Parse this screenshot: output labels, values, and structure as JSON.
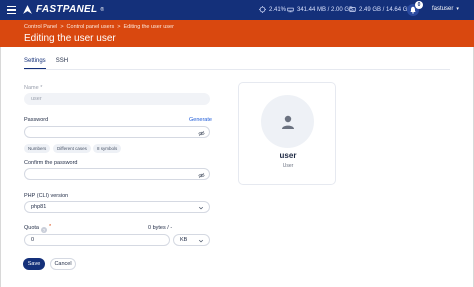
{
  "topbar": {
    "brand": "FASTPANEL",
    "brand_reg": "®",
    "cpu": "2.41%",
    "memory": "341.44 MB / 2.00 GB",
    "disk": "2.49 GB / 14.64 GB",
    "notifications_count": "0",
    "username": "fastuser"
  },
  "header": {
    "breadcrumbs": [
      "Control Panel",
      "Control panel users",
      "Editing the user user"
    ],
    "breadcrumb_sep": ">",
    "title": "Editing the user user"
  },
  "tabs": [
    {
      "label": "Settings",
      "active": true
    },
    {
      "label": "SSH",
      "active": false
    }
  ],
  "form": {
    "name_label": "Name",
    "name_required": "*",
    "name_value": "user",
    "password_label": "Password",
    "generate_link": "Generate",
    "password_value": "",
    "password_hints": [
      "Numbers",
      "Different cases",
      "8 symbols"
    ],
    "confirm_label": "Confirm the password",
    "confirm_value": "",
    "php_label": "PHP (CLI) version",
    "php_value": "php81",
    "quota_label": "Quota",
    "quota_required": "*",
    "quota_usage": "0 bytes / -",
    "quota_value": "0",
    "quota_unit": "KB"
  },
  "buttons": {
    "save": "Save",
    "cancel": "Cancel"
  },
  "user_card": {
    "name": "user",
    "role": "User"
  },
  "colors": {
    "topbar": "#14307a",
    "header": "#d9480f",
    "primary": "#14307a",
    "link": "#1e5bd8"
  }
}
